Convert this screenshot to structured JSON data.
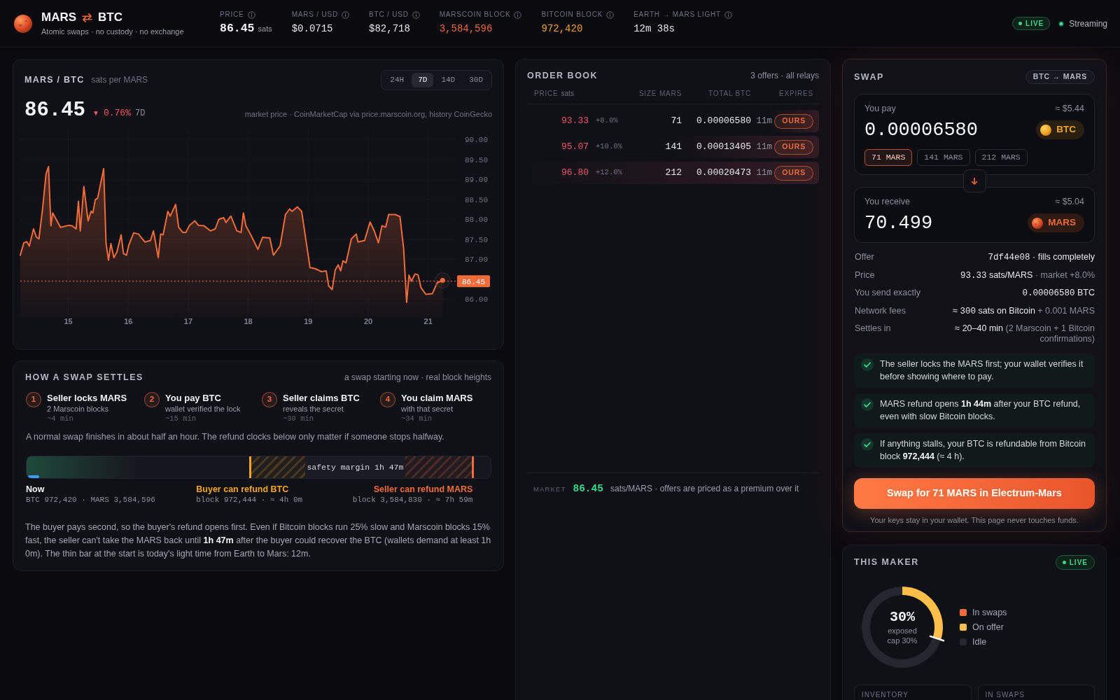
{
  "header": {
    "brand": {
      "base": "MARS",
      "quote": "BTC",
      "tagline": "Atomic swaps · no custody · no exchange"
    },
    "stats": [
      {
        "kind": "price",
        "label": "PRICE",
        "value": "86.45",
        "unit": "sats",
        "color": "#f4f4f6"
      },
      {
        "kind": "plain",
        "label": "MARS / USD",
        "value": "$0.0715",
        "color": "#e6e7ec"
      },
      {
        "kind": "plain",
        "label": "BTC / USD",
        "value": "$82,718",
        "color": "#e6e7ec"
      },
      {
        "kind": "plain",
        "label": "MARSCOIN BLOCK",
        "value": "3,584,596",
        "color": "#f26b3a"
      },
      {
        "kind": "plain",
        "label": "BITCOIN BLOCK",
        "value": "972,420",
        "color": "#f5a524"
      },
      {
        "kind": "plain",
        "label": "EARTH → MARS LIGHT",
        "value": "12m 38s",
        "color": "#e6e7ec"
      }
    ],
    "live_badge": "LIVE",
    "stream_status": "Streaming"
  },
  "chart_panel": {
    "pair": "MARS / BTC",
    "unit": "sats per MARS",
    "ranges": [
      {
        "label": "24H",
        "selected": false
      },
      {
        "label": "7D",
        "selected": true
      },
      {
        "label": "14D",
        "selected": false
      },
      {
        "label": "30D",
        "selected": false
      }
    ],
    "price": "86.45",
    "change": {
      "arrow": "▼",
      "value": "0.76%",
      "period": "7D"
    },
    "source": "market price · CoinMarketCap via price.marscoin.org, history CoinGecko",
    "chart_data": {
      "type": "area",
      "x": [
        14.2,
        14.26,
        14.31,
        14.35,
        14.42,
        14.47,
        14.51,
        14.57,
        14.63,
        14.67,
        14.71,
        14.74,
        14.87,
        15.01,
        15.06,
        15.13,
        15.17,
        15.2,
        15.26,
        15.33,
        15.38,
        15.41,
        15.45,
        15.49,
        15.59,
        15.63,
        15.67,
        15.71,
        15.76,
        15.81,
        15.88,
        15.92,
        15.97,
        16.01,
        16.09,
        16.17,
        16.28,
        16.37,
        16.42,
        16.5,
        16.54,
        16.58,
        16.66,
        16.7,
        16.79,
        16.84,
        16.91,
        16.96,
        17.02,
        17.11,
        17.17,
        17.26,
        17.37,
        17.45,
        17.51,
        17.59,
        17.63,
        17.71,
        17.81,
        17.88,
        17.92,
        17.96,
        18.05,
        18.16,
        18.24,
        18.36,
        18.42,
        18.53,
        18.62,
        18.69,
        18.73,
        18.82,
        18.89,
        18.97,
        19.03,
        19.12,
        19.22,
        19.3,
        19.34,
        19.4,
        19.45,
        19.5,
        19.54,
        19.58,
        19.63,
        19.72,
        19.8,
        19.83,
        19.94,
        20.03,
        20.1,
        20.17,
        20.23,
        20.29,
        20.34,
        20.45,
        20.53,
        20.59,
        20.64,
        20.68,
        20.72,
        20.78,
        20.83,
        20.88,
        20.96,
        21.07,
        21.15,
        21.24
      ],
      "series": [
        {
          "color": "#f26b3a",
          "values": [
            87.1,
            87.41,
            87.44,
            87.33,
            87.76,
            87.55,
            87.51,
            88.24,
            89.14,
            89.32,
            87.84,
            88.16,
            87.8,
            87.85,
            87.84,
            87.76,
            88.45,
            87.71,
            88.82,
            87.96,
            88.2,
            88.16,
            88.49,
            88.53,
            89.27,
            87.39,
            86.98,
            87.39,
            87.04,
            87.18,
            87.61,
            87.14,
            87.1,
            87.36,
            87.66,
            87.63,
            87.43,
            87.47,
            87.71,
            87.04,
            87.63,
            87.61,
            88.2,
            88.08,
            88.37,
            87.8,
            87.67,
            87.67,
            87.85,
            87.96,
            87.85,
            87.84,
            87.71,
            87.76,
            88.0,
            88.04,
            87.92,
            88.08,
            87.71,
            87.67,
            88.16,
            87.84,
            87.59,
            87.25,
            87.55,
            87.53,
            87.1,
            87.33,
            88.12,
            88.26,
            88.2,
            88.31,
            88.2,
            87.39,
            86.79,
            86.76,
            86.69,
            86.71,
            86.33,
            86.24,
            86.73,
            86.86,
            86.71,
            86.96,
            86.91,
            87.51,
            87.63,
            87.43,
            87.47,
            87.93,
            87.71,
            87.41,
            87.84,
            87.8,
            88.12,
            88.12,
            88.07,
            87.27,
            85.92,
            86.6,
            86.45,
            86.63,
            86.61,
            86.29,
            86.12,
            86.14,
            86.41,
            86.47
          ]
        }
      ],
      "xlim": [
        14.2,
        21.47
      ],
      "ylim": [
        85.55,
        90.25
      ],
      "xticks": [
        15,
        16,
        17,
        18,
        19,
        20,
        21
      ],
      "yticks": [
        {
          "value": 86,
          "label": "86.00"
        },
        {
          "value": 87,
          "label": "87.00"
        },
        {
          "value": 87.5,
          "label": "87.50"
        },
        {
          "value": 88,
          "label": "88.00"
        },
        {
          "value": 88.5,
          "label": "88.50"
        },
        {
          "value": 89,
          "label": "89.00"
        },
        {
          "value": 89.5,
          "label": "89.50"
        },
        {
          "value": 90,
          "label": "90.00"
        }
      ],
      "grid": true,
      "ref_lines": [
        {
          "axis": "y",
          "value": 86.45,
          "label": "86.45"
        }
      ]
    }
  },
  "settlement": {
    "title": "HOW A SWAP SETTLES",
    "note": "a swap starting now · real block heights",
    "steps": [
      {
        "number": "1",
        "title": "Seller locks MARS",
        "detail": "2 Marscoin blocks",
        "time": "~4 min"
      },
      {
        "number": "2",
        "title": "You pay BTC",
        "detail": "wallet verified the lock",
        "time": "~15 min"
      },
      {
        "number": "3",
        "title": "Seller claims BTC",
        "detail": "reveals the secret",
        "time": "~30 min"
      },
      {
        "number": "4",
        "title": "You claim MARS",
        "detail": "with that secret",
        "time": "~34 min"
      }
    ],
    "summary": "A normal swap finishes in about half an hour. The refund clocks below only matter if someone stops halfway.",
    "timeline": {
      "margin_label": "safety margin 1h 47m",
      "milestones": [
        {
          "kind": "start",
          "title": "Now",
          "detail": "BTC 972,420 · MARS 3,584,596",
          "color": "#f0f0f3"
        },
        {
          "kind": "buyer_refund",
          "title": "Buyer can refund BTC",
          "detail": "block 972,444 · ≈ 4h 0m",
          "color": "#f5a524"
        },
        {
          "kind": "seller_refund",
          "title": "Seller can refund MARS",
          "detail": "block 3,584,830 · ≈ 7h 59m",
          "color": "#f26b3a"
        }
      ]
    },
    "explanation": "The buyer pays second, so the buyer's refund opens first. Even if Bitcoin blocks run 25% slow and Marscoin blocks 15% fast, the seller can't take the MARS back until **1h 47m** after the buyer could recover the BTC (wallets demand at least 1h 0m). The thin bar at the start is today's light time from Earth to Mars: 12m."
  },
  "order_book": {
    "title": "ORDER BOOK",
    "summary": "3 offers · all relays",
    "columns": [
      {
        "label": "PRICE",
        "unit": "sats"
      },
      {
        "label": "SIZE MARS"
      },
      {
        "label": "TOTAL BTC"
      },
      {
        "label": "EXPIRES"
      }
    ],
    "rows": [
      {
        "price": "93.33",
        "premium": "+8.0%",
        "size": "71",
        "total": "0.00006580",
        "expires": "11m",
        "badge": "OURS",
        "level": 0.17
      },
      {
        "price": "95.07",
        "premium": "+10.0%",
        "size": "141",
        "total": "0.00013405",
        "expires": "11m",
        "badge": "OURS",
        "level": 0.5
      },
      {
        "price": "96.80",
        "premium": "+12.0%",
        "size": "212",
        "total": "0.00020473",
        "expires": "11m",
        "badge": "OURS",
        "level": 1
      }
    ],
    "market": {
      "label": "MARKET",
      "price": "86.45",
      "note": "sats/MARS · offers are priced as a premium over it"
    }
  },
  "swap": {
    "title": "SWAP",
    "direction": "BTC → MARS",
    "pay": {
      "label": "You pay",
      "usd": "≈ $5.44",
      "amount": "0.00006580",
      "token": {
        "kind": "btc",
        "symbol": "BTC"
      },
      "presets": [
        {
          "label": "71 MARS",
          "selected": true
        },
        {
          "label": "141 MARS",
          "selected": false
        },
        {
          "label": "212 MARS",
          "selected": false
        }
      ]
    },
    "receive": {
      "label": "You receive",
      "usd": "≈ $5.04",
      "amount": "70.499",
      "token": {
        "kind": "mars",
        "symbol": "MARS"
      }
    },
    "details": [
      {
        "label": "Offer",
        "parts": [
          {
            "kind": "mono",
            "text": "7df44e08"
          },
          {
            "kind": "plain",
            "text": " · fills completely"
          }
        ]
      },
      {
        "label": "Price",
        "parts": [
          {
            "kind": "mono",
            "text": "93.33"
          },
          {
            "kind": "plain",
            "text": " sats/MARS"
          },
          {
            "kind": "muted",
            "text": " · market +8.0%"
          }
        ]
      },
      {
        "label": "You send exactly",
        "parts": [
          {
            "kind": "mono",
            "text": "0.00006580"
          },
          {
            "kind": "plain",
            "text": " BTC"
          }
        ]
      },
      {
        "label": "Network fees",
        "parts": [
          {
            "kind": "plain",
            "text": "≈ "
          },
          {
            "kind": "mono",
            "text": "300"
          },
          {
            "kind": "plain",
            "text": " sats on Bitcoin"
          },
          {
            "kind": "muted",
            "text": " + 0.001 MARS"
          }
        ]
      },
      {
        "label": "Settles in",
        "parts": [
          {
            "kind": "plain",
            "text": "≈ 20–40 min"
          },
          {
            "kind": "muted",
            "text": " (2 Marscoin + 1 Bitcoin confirmations)"
          }
        ]
      }
    ],
    "guarantees": [
      {
        "text": "The seller locks the MARS first; your wallet verifies it before showing where to pay.",
        "checked": true
      },
      {
        "text": "MARS refund opens **1h 44m** after your BTC refund, even with slow Bitcoin blocks.",
        "checked": true
      },
      {
        "text": "If anything stalls, your BTC is refundable from Bitcoin block **972,444** (≈ 4 h).",
        "checked": true
      }
    ],
    "action": "Swap for 71 MARS in Electrum-Mars",
    "footnote": "Your keys stay in your wallet. This page never touches funds."
  },
  "maker": {
    "title": "THIS MAKER",
    "live_badge": "LIVE",
    "chart_data": {
      "type": "donut",
      "categories": [
        "In swaps",
        "On offer",
        "Idle"
      ],
      "values": [
        0,
        30,
        70
      ],
      "colors": [
        "#f26b3a",
        "#fbbf4a",
        "#25262e"
      ]
    },
    "center": {
      "value": "30%",
      "label": "exposed"
    },
    "cap": {
      "label": "cap 30%",
      "level": 0.3
    },
    "cards": [
      {
        "label": "INVENTORY"
      },
      {
        "label": "IN SWAPS"
      }
    ]
  }
}
